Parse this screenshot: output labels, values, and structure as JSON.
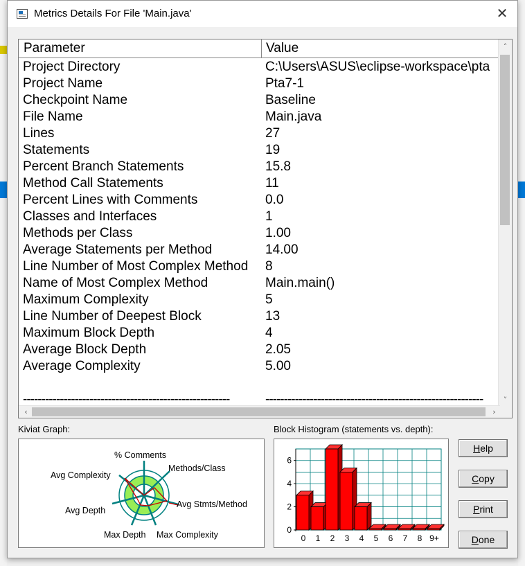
{
  "dialog": {
    "title": "Metrics Details For File 'Main.java'",
    "close_glyph": "✕"
  },
  "table": {
    "headers": [
      "Parameter",
      "Value"
    ],
    "rows": [
      {
        "k": "Project Directory",
        "v": "C:\\Users\\ASUS\\eclipse-workspace\\pta"
      },
      {
        "k": "Project Name",
        "v": "Pta7-1"
      },
      {
        "k": "Checkpoint Name",
        "v": "Baseline"
      },
      {
        "k": "File Name",
        "v": "Main.java"
      },
      {
        "k": "Lines",
        "v": "27"
      },
      {
        "k": "Statements",
        "v": "19"
      },
      {
        "k": "Percent Branch Statements",
        "v": "15.8"
      },
      {
        "k": "Method Call Statements",
        "v": "11"
      },
      {
        "k": "Percent Lines with Comments",
        "v": "0.0"
      },
      {
        "k": "Classes and Interfaces",
        "v": "1"
      },
      {
        "k": "Methods per Class",
        "v": "1.00"
      },
      {
        "k": "Average Statements per Method",
        "v": "14.00"
      },
      {
        "k": "Line Number of Most Complex Method",
        "v": "8"
      },
      {
        "k": "Name of Most Complex Method",
        "v": "Main.main()"
      },
      {
        "k": "Maximum Complexity",
        "v": "5"
      },
      {
        "k": "Line Number of Deepest Block",
        "v": "13"
      },
      {
        "k": "Maximum Block Depth",
        "v": "4"
      },
      {
        "k": "Average Block Depth",
        "v": "2.05"
      },
      {
        "k": "Average Complexity",
        "v": "5.00"
      },
      {
        "k": "",
        "v": ""
      },
      {
        "k": "--------------------------------------------------------",
        "v": "-----------------------------------------------------------"
      }
    ]
  },
  "kiviat": {
    "label": "Kiviat Graph:",
    "axes": [
      "% Comments",
      "Methods/Class",
      "Avg Stmts/Method",
      "Max Complexity",
      "Max Depth",
      "Avg Depth",
      "Avg Complexity"
    ]
  },
  "chart_data": {
    "type": "bar",
    "title": "Block Histogram (statements vs. depth):",
    "categories": [
      "0",
      "1",
      "2",
      "3",
      "4",
      "5",
      "6",
      "7",
      "8",
      "9+"
    ],
    "values": [
      3,
      2,
      7,
      5,
      2,
      0,
      0,
      0,
      0,
      0
    ],
    "yticks": [
      "0",
      "2",
      "4",
      "6"
    ],
    "ylim": [
      0,
      7
    ],
    "grid": true,
    "bar_color": "#ff0000"
  },
  "buttons": {
    "help": {
      "label": "Help",
      "mn": "H",
      "rest": "elp"
    },
    "copy": {
      "label": "Copy",
      "mn": "C",
      "rest": "opy"
    },
    "print": {
      "label": "Print",
      "mn": "P",
      "rest": "rint"
    },
    "done": {
      "label": "Done",
      "mn": "D",
      "rest": "one"
    }
  }
}
